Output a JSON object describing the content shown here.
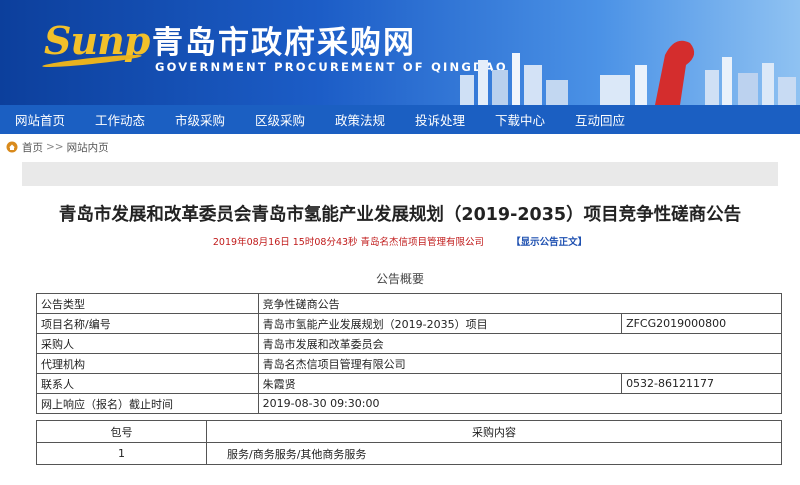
{
  "header": {
    "logo_text": "Sunp",
    "title": "青岛市政府采购网",
    "subtitle": "GOVERNMENT PROCUREMENT OF QINGDAO"
  },
  "nav": {
    "items": [
      {
        "label": "网站首页"
      },
      {
        "label": "工作动态"
      },
      {
        "label": "市级采购"
      },
      {
        "label": "区级采购"
      },
      {
        "label": "政策法规"
      },
      {
        "label": "投诉处理"
      },
      {
        "label": "下载中心"
      },
      {
        "label": "互动回应"
      }
    ]
  },
  "breadcrumb": {
    "home": "首页",
    "separator": ">>",
    "current": "网站内页"
  },
  "article": {
    "title": "青岛市发展和改革委员会青岛市氢能产业发展规划（2019-2035）项目竞争性磋商公告",
    "meta": "2019年08月16日 15时08分43秒  青岛名杰信项目管理有限公司",
    "show_full_link": "【显示公告正文】",
    "summary_heading": "公告概要"
  },
  "summary_table": {
    "rows": [
      {
        "label": "公告类型",
        "value": "竞争性磋商公告",
        "extra": ""
      },
      {
        "label": "项目名称/编号",
        "value": "青岛市氢能产业发展规划（2019-2035）项目",
        "extra": "ZFCG2019000800"
      },
      {
        "label": "采购人",
        "value": "青岛市发展和改革委员会",
        "extra": ""
      },
      {
        "label": "代理机构",
        "value": "青岛名杰信项目管理有限公司",
        "extra": ""
      },
      {
        "label": "联系人",
        "value": "朱霞贤",
        "extra": "0532-86121177"
      },
      {
        "label": "网上响应（报名）截止时间",
        "value": "2019-08-30 09:30:00",
        "extra": ""
      }
    ]
  },
  "items_table": {
    "headers": [
      "包号",
      "采购内容"
    ],
    "rows": [
      {
        "no": "1",
        "content": "服务/商务服务/其他商务服务"
      }
    ]
  },
  "colors": {
    "nav_bg": "#1b5fc2",
    "meta_red": "#c01b1b",
    "link_blue": "#1d4fb0"
  }
}
